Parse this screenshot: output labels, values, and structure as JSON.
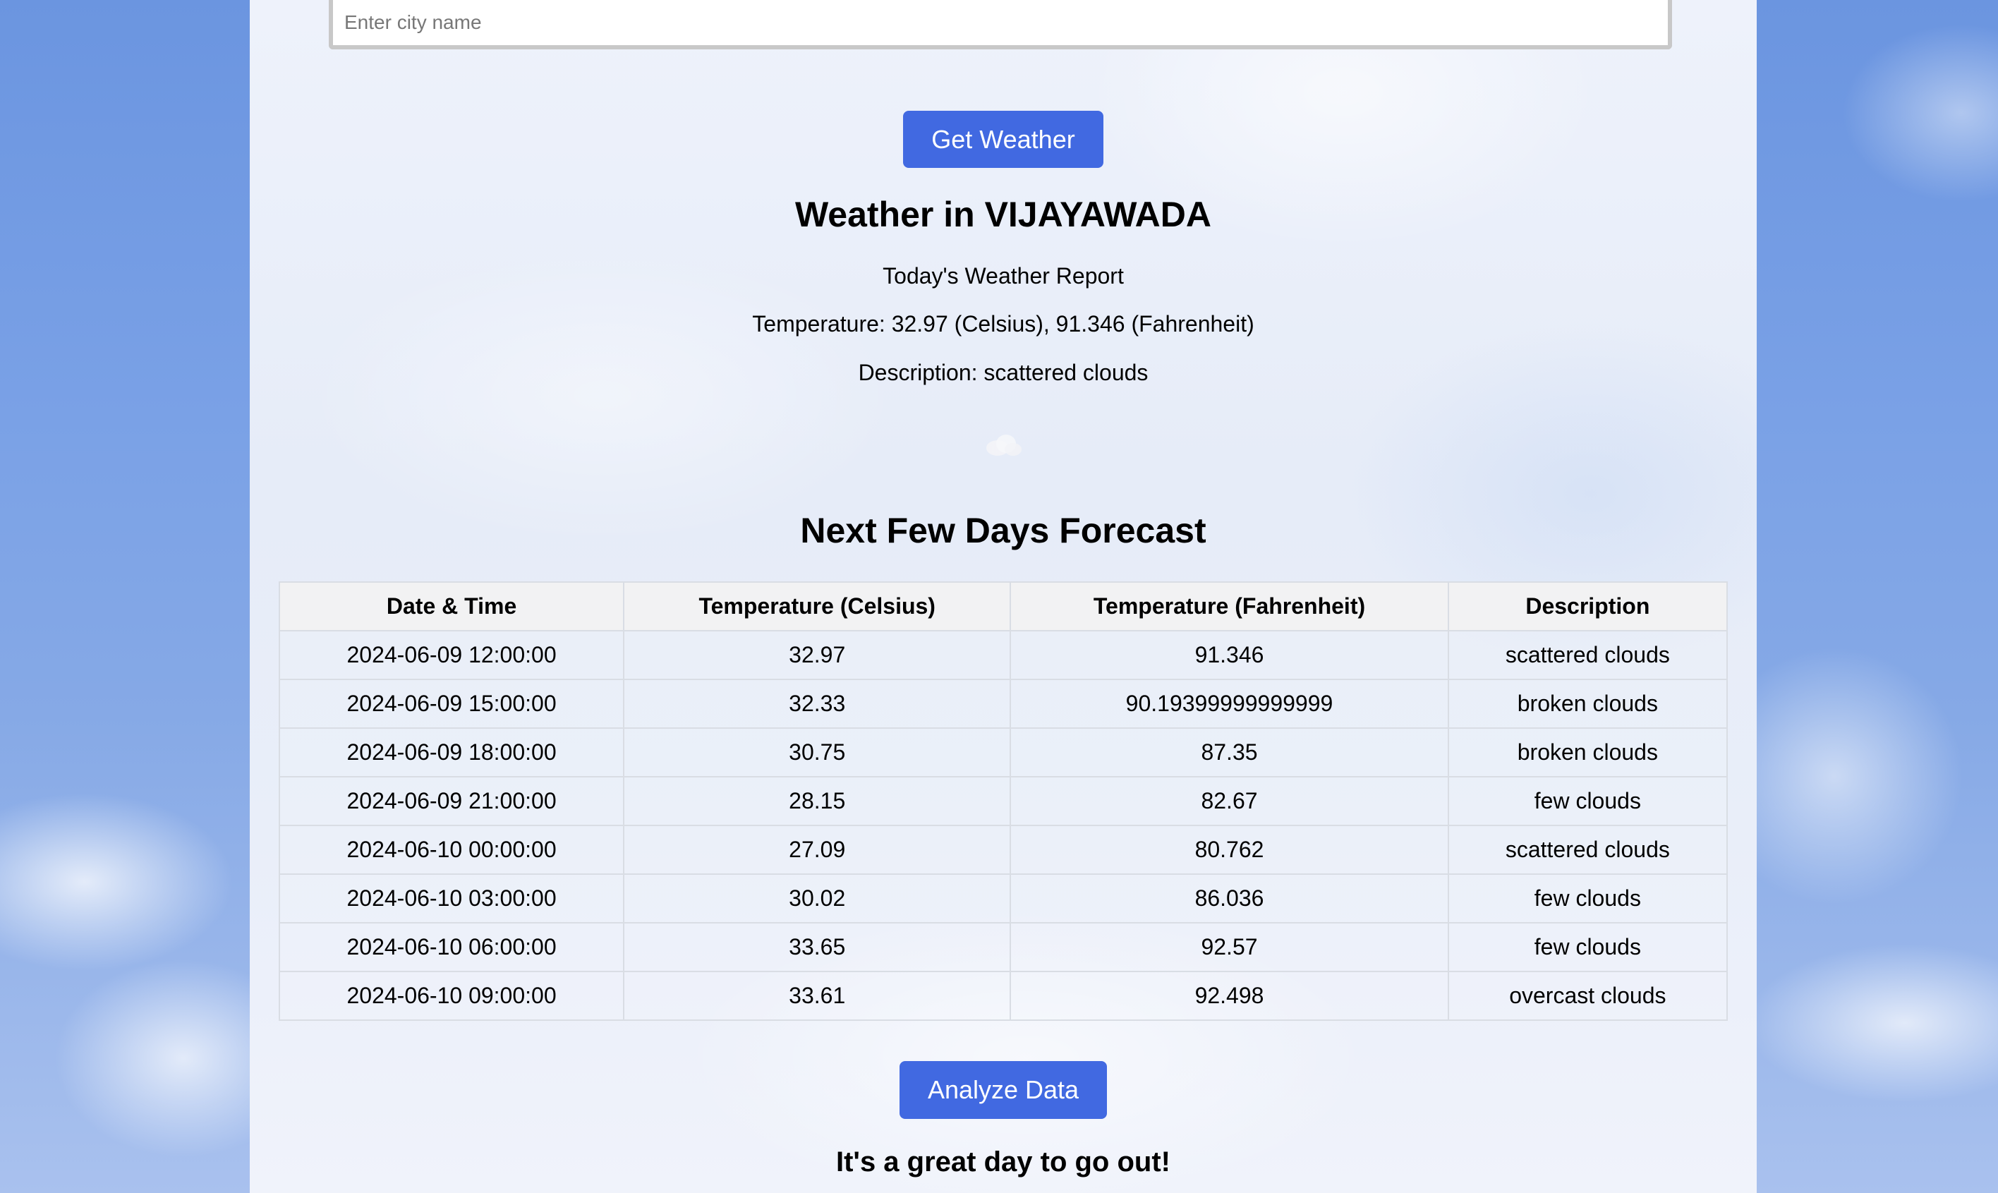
{
  "search": {
    "placeholder": "Enter city name",
    "value": ""
  },
  "buttons": {
    "get_weather": "Get Weather",
    "analyze": "Analyze Data"
  },
  "current": {
    "title": "Weather in VIJAYAWADA",
    "report_label": "Today's Weather Report",
    "temperature": "Temperature: 32.97 (Celsius), 91.346 (Fahrenheit)",
    "description": "Description: scattered clouds",
    "icon": "cloud-icon"
  },
  "forecast": {
    "title": "Next Few Days Forecast",
    "headers": [
      "Date & Time",
      "Temperature (Celsius)",
      "Temperature (Fahrenheit)",
      "Description"
    ],
    "rows": [
      [
        "2024-06-09 12:00:00",
        "32.97",
        "91.346",
        "scattered clouds"
      ],
      [
        "2024-06-09 15:00:00",
        "32.33",
        "90.19399999999999",
        "broken clouds"
      ],
      [
        "2024-06-09 18:00:00",
        "30.75",
        "87.35",
        "broken clouds"
      ],
      [
        "2024-06-09 21:00:00",
        "28.15",
        "82.67",
        "few clouds"
      ],
      [
        "2024-06-10 00:00:00",
        "27.09",
        "80.762",
        "scattered clouds"
      ],
      [
        "2024-06-10 03:00:00",
        "30.02",
        "86.036",
        "few clouds"
      ],
      [
        "2024-06-10 06:00:00",
        "33.65",
        "92.57",
        "few clouds"
      ],
      [
        "2024-06-10 09:00:00",
        "33.61",
        "92.498",
        "overcast clouds"
      ]
    ]
  },
  "verdict": "It's a great day to go out!",
  "colors": {
    "button_bg": "#4169e1",
    "button_text": "#ffffff",
    "header_bg": "#f2f2f2",
    "sky_blue": "#7aa1e6"
  }
}
